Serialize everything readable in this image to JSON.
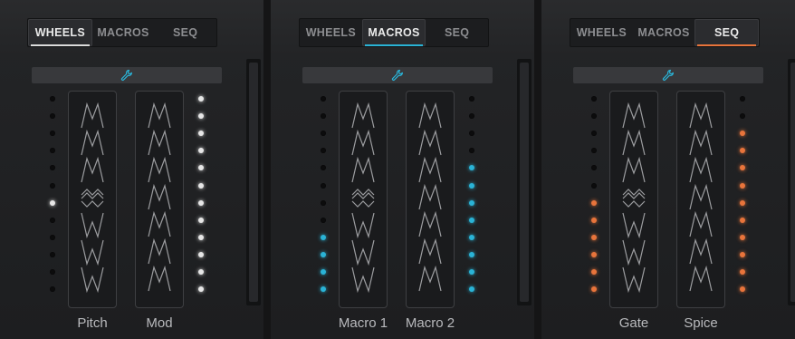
{
  "panels": [
    {
      "tabs": [
        "WHEELS",
        "MACROS",
        "SEQ"
      ],
      "active_tab": 0,
      "accent": "#dcdcdc",
      "settings_icon": "wrench-icon",
      "wheels": [
        {
          "label": "Pitch",
          "type": "center"
        },
        {
          "label": "Mod",
          "type": "up"
        }
      ],
      "left_leds": {
        "count": 12,
        "lit": [
          6
        ],
        "color": "#e6e6e6"
      },
      "right_leds": {
        "count": 12,
        "lit": [
          0,
          1,
          2,
          3,
          4,
          5,
          6,
          7,
          8,
          9,
          10,
          11
        ],
        "color": "#e6e6e6"
      }
    },
    {
      "tabs": [
        "WHEELS",
        "MACROS",
        "SEQ"
      ],
      "active_tab": 1,
      "accent": "#2ab3d6",
      "settings_icon": "wrench-icon",
      "wheels": [
        {
          "label": "Macro 1",
          "type": "center"
        },
        {
          "label": "Macro 2",
          "type": "up"
        }
      ],
      "left_leds": {
        "count": 12,
        "lit": [
          8,
          9,
          10,
          11
        ],
        "color": "#2ab3d6"
      },
      "right_leds": {
        "count": 12,
        "lit": [
          4,
          5,
          6,
          7,
          8,
          9,
          10,
          11
        ],
        "color": "#2ab3d6"
      }
    },
    {
      "tabs": [
        "WHEELS",
        "MACROS",
        "SEQ"
      ],
      "active_tab": 2,
      "accent": "#e8743b",
      "settings_icon": "wrench-icon",
      "wheels": [
        {
          "label": "Gate",
          "type": "center"
        },
        {
          "label": "Spice",
          "type": "up"
        }
      ],
      "left_leds": {
        "count": 12,
        "lit": [
          6,
          7,
          8,
          9,
          10,
          11
        ],
        "color": "#e8743b"
      },
      "right_leds": {
        "count": 12,
        "lit": [
          2,
          3,
          4,
          5,
          6,
          7,
          8,
          9,
          10,
          11
        ],
        "color": "#e8743b"
      }
    }
  ]
}
